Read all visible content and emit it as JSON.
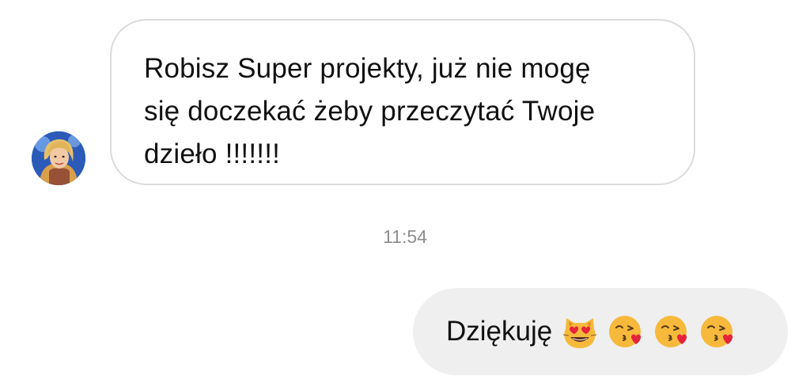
{
  "incoming_message": {
    "lines": [
      "Robisz Super projekty, już nie mogę",
      "się doczekać żeby przeczytać Twoje",
      "dzieło !!!!!!!"
    ]
  },
  "timestamp": "11:54",
  "outgoing_message": {
    "text": "Dziękuję",
    "emojis": [
      "smiling-cat-heart-eyes-icon",
      "face-blowing-kiss-icon",
      "face-blowing-kiss-icon",
      "face-blowing-kiss-icon"
    ]
  },
  "colors": {
    "incoming_border": "#dbdbdb",
    "outgoing_background": "#efefef",
    "timestamp": "#8e8e8e",
    "text": "#111111",
    "emoji_yellow": "#f6b93b"
  },
  "avatar": {
    "icon": "user-avatar"
  }
}
